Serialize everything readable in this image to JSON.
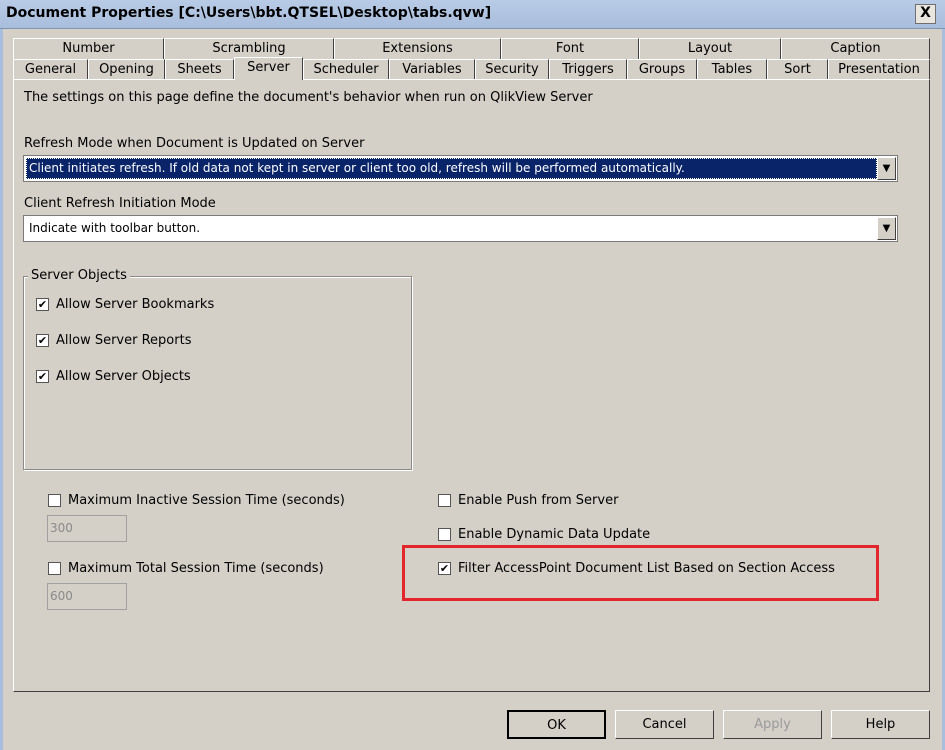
{
  "window": {
    "title": "Document Properties [C:\\Users\\bbt.QTSEL\\Desktop\\tabs.qvw]",
    "close_label": "X"
  },
  "tabs_row1": [
    {
      "label": "Number"
    },
    {
      "label": "Scrambling"
    },
    {
      "label": "Extensions"
    },
    {
      "label": "Font"
    },
    {
      "label": "Layout"
    },
    {
      "label": "Caption"
    }
  ],
  "tabs_row2": [
    {
      "label": "General"
    },
    {
      "label": "Opening"
    },
    {
      "label": "Sheets"
    },
    {
      "label": "Server",
      "active": true
    },
    {
      "label": "Scheduler"
    },
    {
      "label": "Variables"
    },
    {
      "label": "Security"
    },
    {
      "label": "Triggers"
    },
    {
      "label": "Groups"
    },
    {
      "label": "Tables"
    },
    {
      "label": "Sort"
    },
    {
      "label": "Presentation"
    }
  ],
  "server": {
    "description": "The settings on this page define the document's behavior when run on QlikView Server",
    "refresh_mode_label": "Refresh Mode when Document is Updated on Server",
    "refresh_mode_value": "Client initiates refresh. If old data not kept in server or client too old, refresh will be performed automatically.",
    "client_refresh_label": "Client Refresh Initiation Mode",
    "client_refresh_value": "Indicate with toolbar button.",
    "server_objects": {
      "group_label": "Server Objects",
      "allow_bookmarks": {
        "label": "Allow Server Bookmarks",
        "checked": true
      },
      "allow_reports": {
        "label": "Allow Server Reports",
        "checked": true
      },
      "allow_objects": {
        "label": "Allow Server Objects",
        "checked": true
      }
    },
    "max_inactive": {
      "label": "Maximum Inactive Session Time (seconds)",
      "checked": false,
      "value": "300"
    },
    "max_total": {
      "label": "Maximum Total Session Time (seconds)",
      "checked": false,
      "value": "600"
    },
    "enable_push": {
      "label": "Enable Push from Server",
      "checked": false
    },
    "enable_dynamic": {
      "label": "Enable Dynamic Data Update",
      "checked": false
    },
    "filter_accesspoint": {
      "label": "Filter AccessPoint Document List Based on Section Access",
      "checked": true
    }
  },
  "buttons": {
    "ok": "OK",
    "cancel": "Cancel",
    "apply": "Apply",
    "help": "Help"
  },
  "colors": {
    "highlight": "#e3262b",
    "selection": "#0a246a",
    "dialog": "#d4d0c8"
  },
  "icons": {
    "check": "✔",
    "dropdown": "▼"
  }
}
